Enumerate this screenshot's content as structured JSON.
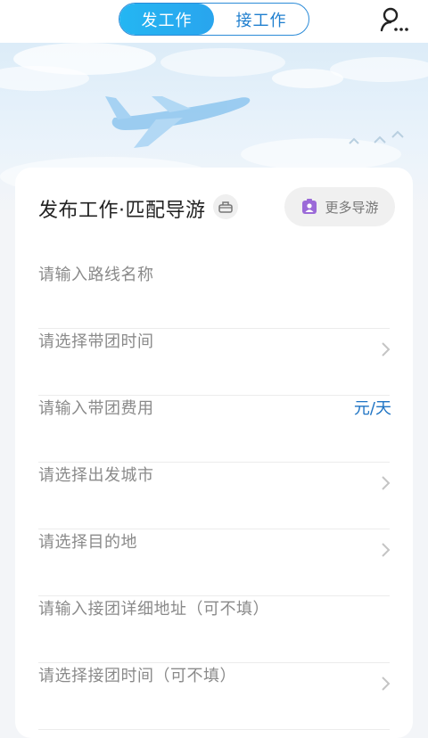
{
  "header": {
    "tabs": [
      {
        "label": "发工作",
        "active": true
      },
      {
        "label": "接工作",
        "active": false
      }
    ],
    "user_icon": "user-search-icon",
    "accent_color": "#29a5ee"
  },
  "card": {
    "title": "发布工作·匹配导游",
    "title_icon": "basket-icon",
    "more_button": {
      "label": "更多导游",
      "icon": "id-badge-icon",
      "icon_color": "#9b6ad8"
    },
    "fields": [
      {
        "placeholder": "请输入路线名称",
        "has_chevron": false,
        "unit": ""
      },
      {
        "placeholder": "请选择带团时间",
        "has_chevron": true,
        "unit": ""
      },
      {
        "placeholder": "请输入带团费用",
        "has_chevron": false,
        "unit": "元/天"
      },
      {
        "placeholder": "请选择出发城市",
        "has_chevron": true,
        "unit": ""
      },
      {
        "placeholder": "请选择目的地",
        "has_chevron": true,
        "unit": ""
      },
      {
        "placeholder": "请输入接团详细地址（可不填）",
        "has_chevron": false,
        "unit": ""
      },
      {
        "placeholder": "请选择接团时间（可不填）",
        "has_chevron": true,
        "unit": ""
      }
    ]
  }
}
